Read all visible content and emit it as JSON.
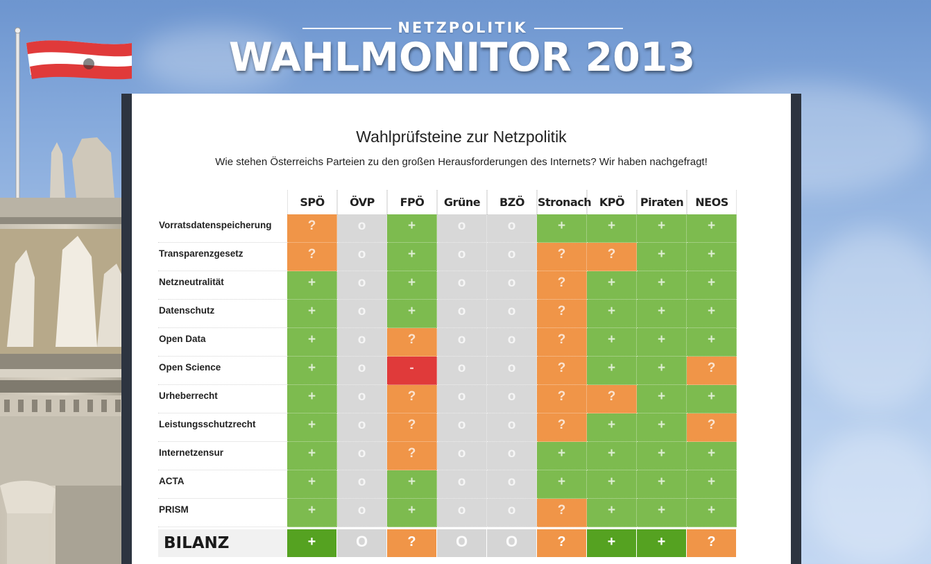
{
  "header": {
    "kicker": "NETZPOLITIK",
    "title": "WAHLMONITOR 2013"
  },
  "panel": {
    "title": "Wahlprüfsteine zur Netzpolitik",
    "subtitle": "Wie stehen Österreichs Parteien zu den großen Herausforderungen des Internets? Wir haben nachgefragt!"
  },
  "table": {
    "parties": [
      "SPÖ",
      "ÖVP",
      "FPÖ",
      "Grüne",
      "BZÖ",
      "Stronach",
      "KPÖ",
      "Piraten",
      "NEOS"
    ],
    "symbols": {
      "plus": "+",
      "zero": "o",
      "q": "?",
      "minus": "-"
    },
    "colors": {
      "plus": "#7dbb4f",
      "zero": "#d8d8d8",
      "q": "#f09548",
      "minus": "#e03a3a",
      "bilanz_plus": "#55a221"
    },
    "rows": [
      {
        "topic": "Vorratsdatenspeicherung",
        "values": [
          "q",
          "zero",
          "plus",
          "zero",
          "zero",
          "plus",
          "plus",
          "plus",
          "plus"
        ]
      },
      {
        "topic": "Transparenzgesetz",
        "values": [
          "q",
          "zero",
          "plus",
          "zero",
          "zero",
          "q",
          "q",
          "plus",
          "plus"
        ]
      },
      {
        "topic": "Netzneutralität",
        "values": [
          "plus",
          "zero",
          "plus",
          "zero",
          "zero",
          "q",
          "plus",
          "plus",
          "plus"
        ]
      },
      {
        "topic": "Datenschutz",
        "values": [
          "plus",
          "zero",
          "plus",
          "zero",
          "zero",
          "q",
          "plus",
          "plus",
          "plus"
        ]
      },
      {
        "topic": "Open Data",
        "values": [
          "plus",
          "zero",
          "q",
          "zero",
          "zero",
          "q",
          "plus",
          "plus",
          "plus"
        ]
      },
      {
        "topic": "Open Science",
        "values": [
          "plus",
          "zero",
          "minus",
          "zero",
          "zero",
          "q",
          "plus",
          "plus",
          "q"
        ]
      },
      {
        "topic": "Urheberrecht",
        "values": [
          "plus",
          "zero",
          "q",
          "zero",
          "zero",
          "q",
          "q",
          "plus",
          "plus"
        ]
      },
      {
        "topic": "Leistungsschutzrecht",
        "values": [
          "plus",
          "zero",
          "q",
          "zero",
          "zero",
          "q",
          "plus",
          "plus",
          "q"
        ]
      },
      {
        "topic": "Internetzensur",
        "values": [
          "plus",
          "zero",
          "q",
          "zero",
          "zero",
          "plus",
          "plus",
          "plus",
          "plus"
        ]
      },
      {
        "topic": "ACTA",
        "values": [
          "plus",
          "zero",
          "plus",
          "zero",
          "zero",
          "plus",
          "plus",
          "plus",
          "plus"
        ]
      },
      {
        "topic": "PRISM",
        "values": [
          "plus",
          "zero",
          "plus",
          "zero",
          "zero",
          "q",
          "plus",
          "plus",
          "plus"
        ]
      }
    ],
    "bilanz": {
      "label": "BILANZ",
      "symbols": {
        "plus": "+",
        "zero": "O",
        "q": "?",
        "minus": "-"
      },
      "values": [
        "plus",
        "zero",
        "q",
        "zero",
        "zero",
        "q",
        "plus",
        "plus",
        "q"
      ]
    }
  }
}
